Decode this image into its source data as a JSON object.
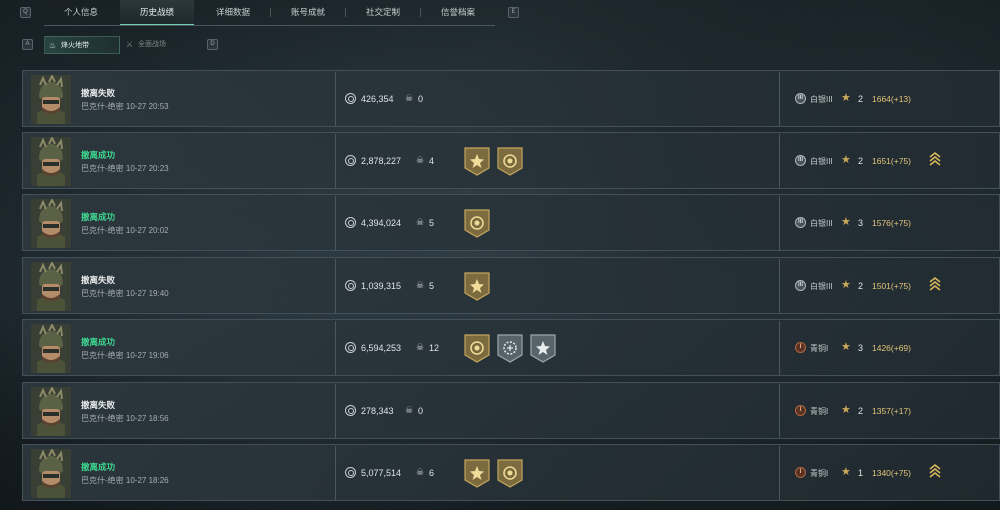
{
  "nav": {
    "left_key": "Q",
    "right_key": "E",
    "tabs": [
      "个人信息",
      "历史战绩",
      "详细数据",
      "账号成就",
      "社交定制",
      "信誉档案"
    ],
    "active_index": 1
  },
  "subnav": {
    "left_key": "A",
    "right_key": "D",
    "tabs": [
      "烽火地带",
      "全面战场"
    ],
    "active_index": 0
  },
  "colors": {
    "success": "#3fd68f",
    "fail": "#e6e9ea",
    "score": "#e2c57a",
    "medal_gold": "#8a7645",
    "medal_gray": "#5a6468"
  },
  "rows": [
    {
      "status": "撤离失败",
      "result": "fail",
      "meta": "巴克什-绝密 10-27 20:53",
      "value": "426,354",
      "kills": "0",
      "medals": [],
      "rank": "白银III",
      "rank_tier": "silver",
      "rank_glyph": "III",
      "stars": "2",
      "score": "1664(+13)",
      "promotion": false
    },
    {
      "status": "撤离成功",
      "result": "ok",
      "meta": "巴克什-绝密 10-27 20:23",
      "value": "2,878,227",
      "kills": "4",
      "medals": [
        "gold-star",
        "gold-coin"
      ],
      "rank": "白银III",
      "rank_tier": "silver",
      "rank_glyph": "III",
      "stars": "2",
      "score": "1651(+75)",
      "promotion": true
    },
    {
      "status": "撤离成功",
      "result": "ok",
      "meta": "巴克什-绝密 10-27 20:02",
      "value": "4,394,024",
      "kills": "5",
      "medals": [
        "gold-coin"
      ],
      "rank": "白银III",
      "rank_tier": "silver",
      "rank_glyph": "III",
      "stars": "3",
      "score": "1576(+75)",
      "promotion": false
    },
    {
      "status": "撤离失败",
      "result": "fail",
      "meta": "巴克什-绝密 10-27 19:40",
      "value": "1,039,315",
      "kills": "5",
      "medals": [
        "gold-star"
      ],
      "rank": "白银III",
      "rank_tier": "silver",
      "rank_glyph": "III",
      "stars": "2",
      "score": "1501(+75)",
      "promotion": true
    },
    {
      "status": "撤离成功",
      "result": "ok",
      "meta": "巴克什-绝密 10-27 19:06",
      "value": "6,594,253",
      "kills": "12",
      "medals": [
        "gold-coin",
        "gray-gear",
        "gray-star"
      ],
      "rank": "青铜I",
      "rank_tier": "bronze",
      "rank_glyph": "I",
      "stars": "3",
      "score": "1426(+69)",
      "promotion": false
    },
    {
      "status": "撤离失败",
      "result": "fail",
      "meta": "巴克什-绝密 10-27 18:56",
      "value": "278,343",
      "kills": "0",
      "medals": [],
      "rank": "青铜I",
      "rank_tier": "bronze",
      "rank_glyph": "I",
      "stars": "2",
      "score": "1357(+17)",
      "promotion": false
    },
    {
      "status": "撤离成功",
      "result": "ok",
      "meta": "巴克什-绝密 10-27 18:26",
      "value": "5,077,514",
      "kills": "6",
      "medals": [
        "gold-star",
        "gold-coin"
      ],
      "rank": "青铜I",
      "rank_tier": "bronze",
      "rank_glyph": "I",
      "stars": "1",
      "score": "1340(+75)",
      "promotion": true
    }
  ]
}
